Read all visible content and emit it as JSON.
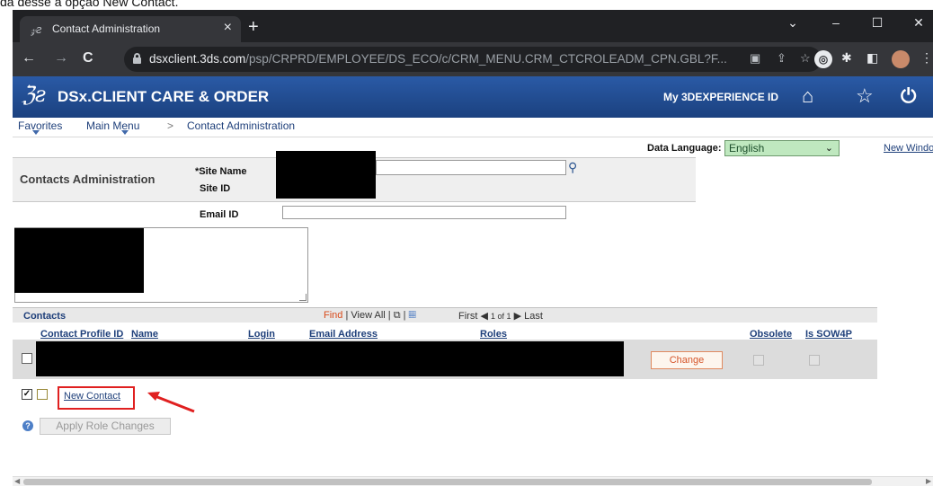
{
  "caption": "da desse a opção New Contact.",
  "browser": {
    "tab_title": "Contact Administration",
    "tab_favicon": "3DS",
    "url_host": "dsxclient.3ds.com",
    "url_path": "/psp/CRPRD/EMPLOYEE/DS_ECO/c/CRM_MENU.CRM_CTCROLEADM_CPN.GBL?F..."
  },
  "app": {
    "logo": "3DS",
    "title": "DSx.CLIENT CARE & ORDER",
    "my_id": "My 3DEXPERIENCE ID"
  },
  "breadcrumb": {
    "favorites": "Favorites",
    "main_menu": "Main Menu",
    "separator": ">",
    "current": "Contact Administration"
  },
  "page": {
    "data_language_label": "Data Language:",
    "data_language_value": "English",
    "new_window": "New Windo",
    "panel_title": "Contacts Administration",
    "site_name_label": "*Site Name",
    "site_id_label": "Site ID",
    "email_id_label": "Email ID"
  },
  "grid": {
    "title": "Contacts",
    "find": "Find",
    "view_all": "View All",
    "sep": "|",
    "first": "First",
    "range": "1 of 1",
    "last": "Last",
    "columns": {
      "contact_profile_id": "Contact Profile ID",
      "name": "Name",
      "login": "Login",
      "email": "Email Address",
      "roles": "Roles",
      "obsolete": "Obsolete",
      "sow4p": "Is SOW4P"
    },
    "change_button": "Change"
  },
  "actions": {
    "new_contact": "New Contact",
    "apply_role_changes": "Apply Role Changes"
  },
  "colors": {
    "header_blue": "#1b417f",
    "highlight_red": "#e02020",
    "link_blue": "#1e3f7a",
    "find_orange": "#d94a1a"
  }
}
